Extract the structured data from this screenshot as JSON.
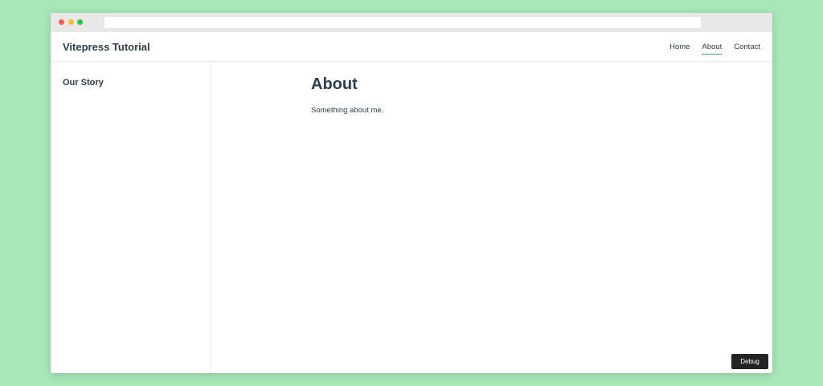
{
  "browser": {
    "controls": [
      "close",
      "minimize",
      "maximize"
    ],
    "address_bar": ""
  },
  "header": {
    "site_title": "Vitepress Tutorial",
    "nav": [
      {
        "label": "Home",
        "active": false
      },
      {
        "label": "About",
        "active": true
      },
      {
        "label": "Contact",
        "active": false
      }
    ]
  },
  "sidebar": {
    "heading": "Our Story"
  },
  "main": {
    "title": "About",
    "text": "Something about me."
  },
  "debug": {
    "label": "Debug"
  },
  "colors": {
    "background": "#a8e8b8",
    "text": "#2c3e50",
    "accent": "#3eaf7c",
    "debug_bg": "#242424"
  }
}
